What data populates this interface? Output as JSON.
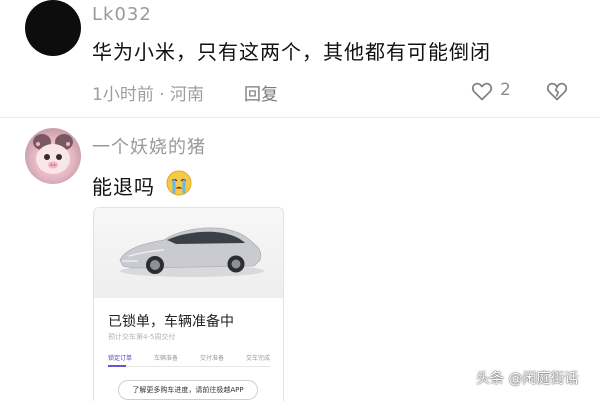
{
  "comment1": {
    "username": "Lk032",
    "text": "华为小米，只有这两个，其他都有可能倒闭",
    "meta": "1小时前 · 河南",
    "reply_label": "回复",
    "like_count": "2"
  },
  "comment2": {
    "username": "一个妖娆的猪",
    "text": "能退吗",
    "emoji": "crying-face-icon",
    "card": {
      "title": "已锁单，车辆准备中",
      "subtitle": "预计交车第4-5周交付",
      "steps": [
        "锁定订单",
        "车辆准备",
        "交付准备",
        "交车完成"
      ],
      "active_step": 0,
      "app_button": "了解更多购车进度，请前往极越APP"
    }
  },
  "watermark": "头条 @闲庭街话",
  "colors": {
    "accent": "#6b54d1",
    "muted": "#9a9a9a",
    "text": "#111111"
  }
}
